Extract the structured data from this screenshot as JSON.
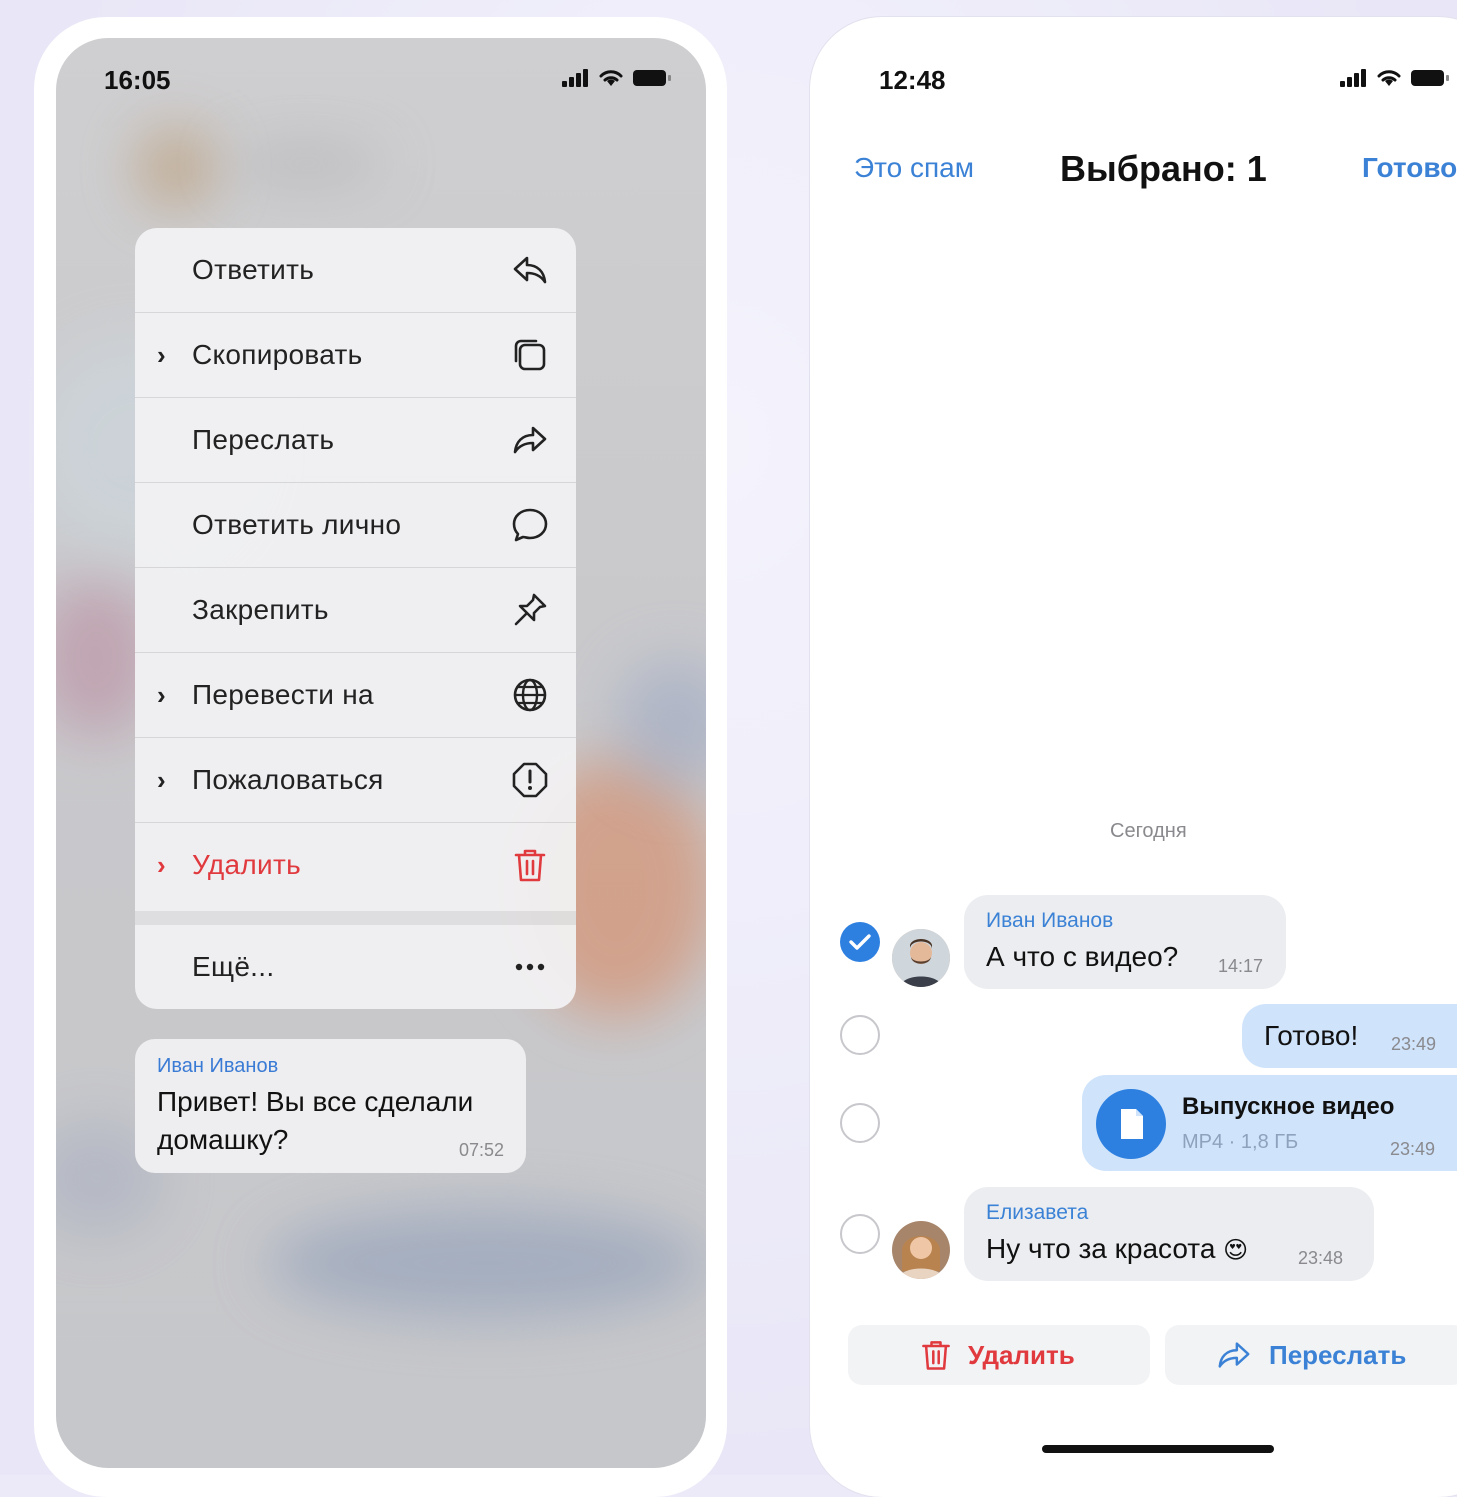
{
  "left_phone": {
    "status_time": "16:05",
    "context_menu": [
      {
        "label": "Ответить",
        "icon": "reply-icon",
        "has_submenu": false
      },
      {
        "label": "Скопировать",
        "icon": "copy-icon",
        "has_submenu": true
      },
      {
        "label": "Переслать",
        "icon": "forward-icon",
        "has_submenu": false
      },
      {
        "label": "Ответить лично",
        "icon": "chat-bubble-icon",
        "has_submenu": false
      },
      {
        "label": "Закрепить",
        "icon": "pin-icon",
        "has_submenu": false
      },
      {
        "label": "Перевести на",
        "icon": "globe-icon",
        "has_submenu": true
      },
      {
        "label": "Пожаловаться",
        "icon": "alert-icon",
        "has_submenu": true
      },
      {
        "label": "Удалить",
        "icon": "trash-icon",
        "has_submenu": true,
        "destructive": true
      },
      {
        "label": "Ещё...",
        "icon": "more-icon",
        "has_submenu": false
      }
    ],
    "message": {
      "sender": "Иван Иванов",
      "text": "Привет! Вы все сделали домашку?",
      "time": "07:52"
    }
  },
  "right_phone": {
    "status_time": "12:48",
    "nav": {
      "left_label": "Это спам",
      "title": "Выбрано: 1",
      "right_label": "Готово"
    },
    "date_separator": "Сегодня",
    "messages": [
      {
        "sender": "Иван Иванов",
        "text": "А что с видео?",
        "time": "14:17",
        "selected": true,
        "direction": "in"
      },
      {
        "text": "Готово!",
        "time": "23:49",
        "selected": false,
        "direction": "out"
      },
      {
        "file_name": "Выпускное видео",
        "file_meta": "MP4 · 1,8 ГБ",
        "time": "23:49",
        "selected": false,
        "direction": "out"
      },
      {
        "sender": "Елизавета",
        "text": "Ну что за красота",
        "emoji": "😍",
        "time": "23:48",
        "selected": false,
        "direction": "in"
      }
    ],
    "actions": {
      "delete_label": "Удалить",
      "forward_label": "Переслать"
    }
  },
  "colors": {
    "accent": "#3b82d6",
    "destructive": "#e0393e",
    "background": "#eceaf8"
  }
}
